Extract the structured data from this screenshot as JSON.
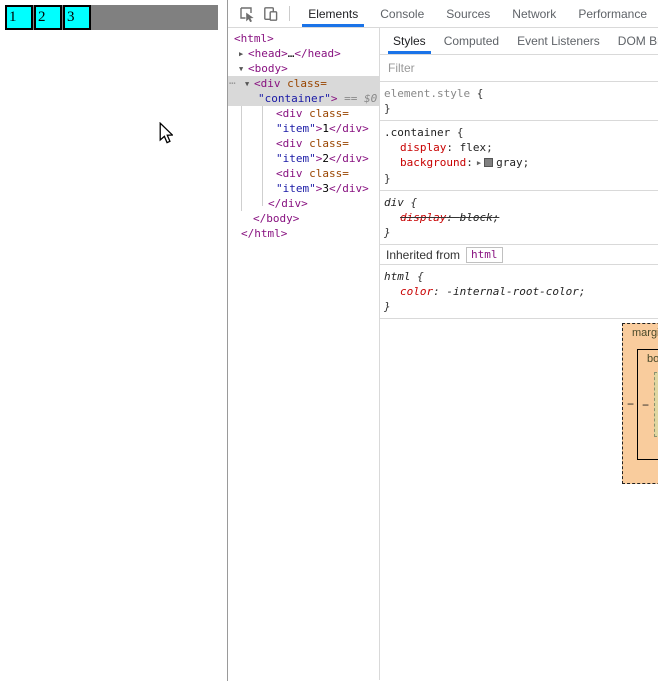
{
  "colors": {
    "accent": "#1a73e8",
    "tab_inactive": "#5f6368",
    "tab_active": "#202124",
    "tag": "#881280",
    "attr": "#994500",
    "str": "#1a1aa6",
    "prop": "#c80000",
    "selection": "#d9d9d9",
    "line": "#d9d9d9",
    "page_gray": "#808080",
    "page_cyan": "#00ffff",
    "bm_margin": "#f9cc9d",
    "bm_padding": "#e0d6a0",
    "bm_padding_dash": "#8a9171",
    "icon": "#6e6e6e"
  },
  "page": {
    "items": [
      "1",
      "2",
      "3"
    ]
  },
  "toolbar": {
    "tabs": [
      "Elements",
      "Console",
      "Sources",
      "Network",
      "Performance"
    ],
    "active_tab": "Elements"
  },
  "dom_tree": {
    "gutter_dots": "…",
    "lines": [
      {
        "indent": 6,
        "segments": [
          {
            "t": "<html>",
            "c": "tag"
          }
        ]
      },
      {
        "indent": 11,
        "arrow": "▶",
        "segments": [
          {
            "t": "<head>",
            "c": "tag"
          },
          {
            "t": "…",
            "c": "txt"
          },
          {
            "t": "</head>",
            "c": "tag"
          }
        ]
      },
      {
        "indent": 11,
        "arrow": "▼",
        "segments": [
          {
            "t": "<body>",
            "c": "tag"
          }
        ]
      },
      {
        "indent": 17,
        "arrow": "▼",
        "selected": true,
        "gutter": true,
        "segments": [
          {
            "t": "<div",
            "c": "tag"
          },
          {
            "t": " ",
            "c": "txt"
          },
          {
            "t": "class=",
            "c": "attr"
          }
        ]
      },
      {
        "indent": 30,
        "selected": true,
        "segments": [
          {
            "t": "\"container\"",
            "c": "str"
          },
          {
            "t": ">",
            "c": "tag"
          },
          {
            "t": " == $0",
            "c": "meta"
          }
        ]
      },
      {
        "indent": 48,
        "segments": [
          {
            "t": "<div",
            "c": "tag"
          },
          {
            "t": " ",
            "c": "txt"
          },
          {
            "t": "class=",
            "c": "attr"
          }
        ]
      },
      {
        "indent": 48,
        "segments": [
          {
            "t": "\"item\"",
            "c": "str"
          },
          {
            "t": ">",
            "c": "tag"
          },
          {
            "t": "1",
            "c": "txt"
          },
          {
            "t": "</div>",
            "c": "tag"
          }
        ]
      },
      {
        "indent": 48,
        "segments": [
          {
            "t": "<div",
            "c": "tag"
          },
          {
            "t": " ",
            "c": "txt"
          },
          {
            "t": "class=",
            "c": "attr"
          }
        ]
      },
      {
        "indent": 48,
        "segments": [
          {
            "t": "\"item\"",
            "c": "str"
          },
          {
            "t": ">",
            "c": "tag"
          },
          {
            "t": "2",
            "c": "txt"
          },
          {
            "t": "</div>",
            "c": "tag"
          }
        ]
      },
      {
        "indent": 48,
        "segments": [
          {
            "t": "<div",
            "c": "tag"
          },
          {
            "t": " ",
            "c": "txt"
          },
          {
            "t": "class=",
            "c": "attr"
          }
        ]
      },
      {
        "indent": 48,
        "segments": [
          {
            "t": "\"item\"",
            "c": "str"
          },
          {
            "t": ">",
            "c": "tag"
          },
          {
            "t": "3",
            "c": "txt"
          },
          {
            "t": "</div>",
            "c": "tag"
          }
        ]
      },
      {
        "indent": 40,
        "segments": [
          {
            "t": "</div>",
            "c": "tag"
          }
        ]
      },
      {
        "indent": 25,
        "segments": [
          {
            "t": "</body>",
            "c": "tag"
          }
        ]
      },
      {
        "indent": 13,
        "segments": [
          {
            "t": "</html>",
            "c": "tag"
          }
        ]
      }
    ]
  },
  "styles_panel": {
    "tabs": [
      "Styles",
      "Computed",
      "Event Listeners",
      "DOM Breakpoints"
    ],
    "active_tab": "Styles",
    "filter_placeholder": "Filter",
    "brace_open": "{",
    "brace_close": "}",
    "rules": [
      {
        "selector": "element.style",
        "muted": true,
        "props": []
      },
      {
        "selector": ".container",
        "props": [
          {
            "name": "display",
            "value": "flex"
          },
          {
            "name": "background",
            "value": "gray",
            "swatch": "#808080",
            "expand_icon": "▶"
          }
        ]
      },
      {
        "selector": "div",
        "italic": true,
        "props": [
          {
            "name": "display",
            "value": "block",
            "struck": true
          }
        ]
      }
    ],
    "inherited": {
      "label": "Inherited from",
      "node": "html",
      "rules": [
        {
          "selector": "html",
          "italic": true,
          "props": [
            {
              "name": "color",
              "value": "-internal-root-color"
            }
          ]
        }
      ]
    }
  },
  "box_model": {
    "margin_label": "margin",
    "border_label": "border",
    "margin_left_value": "−",
    "border_left_value": "−"
  }
}
